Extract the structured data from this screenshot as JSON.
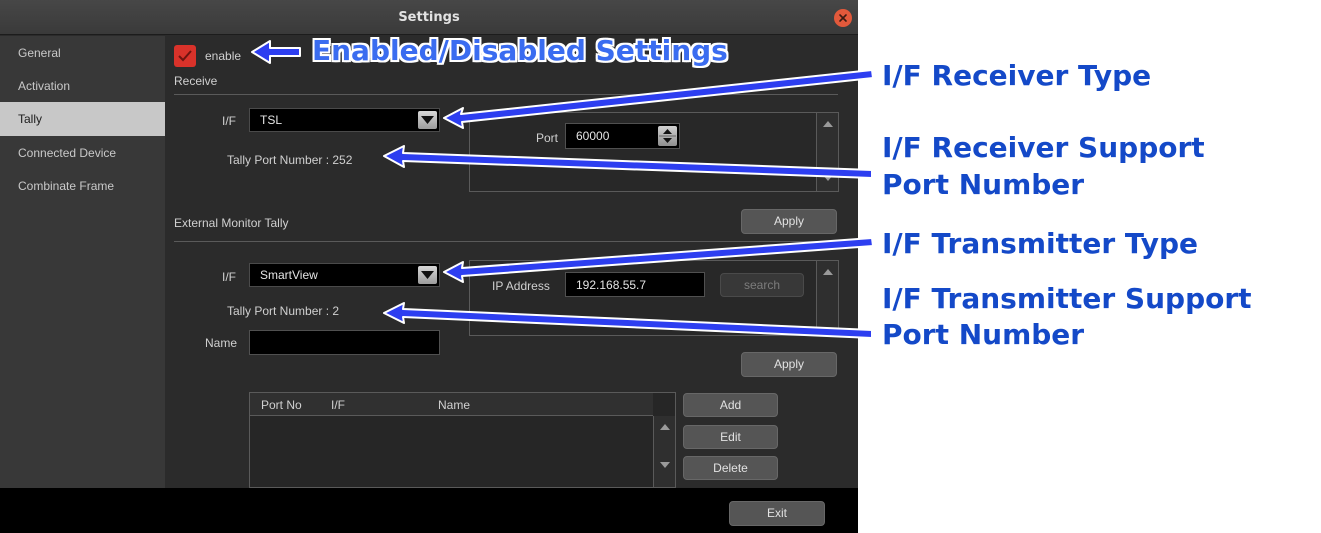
{
  "window": {
    "title": "Settings"
  },
  "sidebar": {
    "items": [
      {
        "label": "General"
      },
      {
        "label": "Activation"
      },
      {
        "label": "Tally"
      },
      {
        "label": "Connected Device"
      },
      {
        "label": "Combinate Frame"
      }
    ],
    "active": "Tally"
  },
  "enable": {
    "label": "enable",
    "checked": true
  },
  "receive": {
    "section_label": "Receive",
    "if_label": "I/F",
    "if_value": "TSL",
    "port_label": "Port",
    "port_value": "60000",
    "tally_port_text": "Tally Port Number : 252",
    "apply_label": "Apply"
  },
  "external": {
    "section_label": "External Monitor Tally",
    "if_label": "I/F",
    "if_value": "SmartView",
    "ip_label": "IP Address",
    "ip_value": "192.168.55.7",
    "search_label": "search",
    "tally_port_text": "Tally Port Number : 2",
    "name_label": "Name",
    "name_value": "",
    "apply_label": "Apply"
  },
  "table": {
    "columns": [
      "Port No",
      "I/F",
      "Name"
    ],
    "rows": []
  },
  "actions": {
    "add_label": "Add",
    "edit_label": "Edit",
    "delete_label": "Delete",
    "exit_label": "Exit"
  },
  "annotations": {
    "enabled": "Enabled/Disabled Settings",
    "receiver_type": "I/F Receiver Type",
    "receiver_port_line1": "I/F Receiver Support",
    "receiver_port_line2": "Port Number",
    "transmitter_type": "I/F Transmitter Type",
    "transmitter_port_line1": "I/F Transmitter Support",
    "transmitter_port_line2": "Port Number"
  },
  "colors": {
    "annotation_text": "#1449c8",
    "annotation_arrow": "#2d3ef0",
    "checkbox": "#d9322a",
    "close_button": "#e2593b"
  },
  "icons": {
    "close": "close-icon",
    "dropdown": "chevron-down-icon",
    "spin": "spin-arrows-icon",
    "checkmark": "checkmark-icon",
    "annotation_arrow": "arrow-left-icon"
  }
}
